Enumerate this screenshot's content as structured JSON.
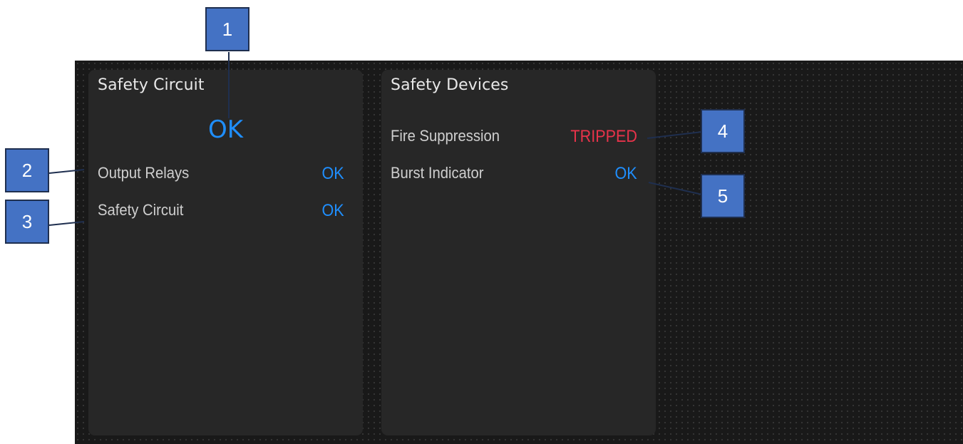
{
  "panels": {
    "safety_circuit": {
      "title": "Safety Circuit",
      "main_status": "OK",
      "rows": [
        {
          "label": "Output Relays",
          "value": "OK"
        },
        {
          "label": "Safety Circuit",
          "value": "OK"
        }
      ]
    },
    "safety_devices": {
      "title": "Safety Devices",
      "rows": [
        {
          "label": "Fire Suppression",
          "value": "TRIPPED"
        },
        {
          "label": "Burst Indicator",
          "value": "OK"
        }
      ]
    }
  },
  "callouts": [
    "1",
    "2",
    "3",
    "4",
    "5"
  ],
  "colors": {
    "ok": "#1f8fff",
    "tripped": "#e8334a",
    "panel": "#272727",
    "background": "#191919",
    "callout": "#4472c4"
  }
}
